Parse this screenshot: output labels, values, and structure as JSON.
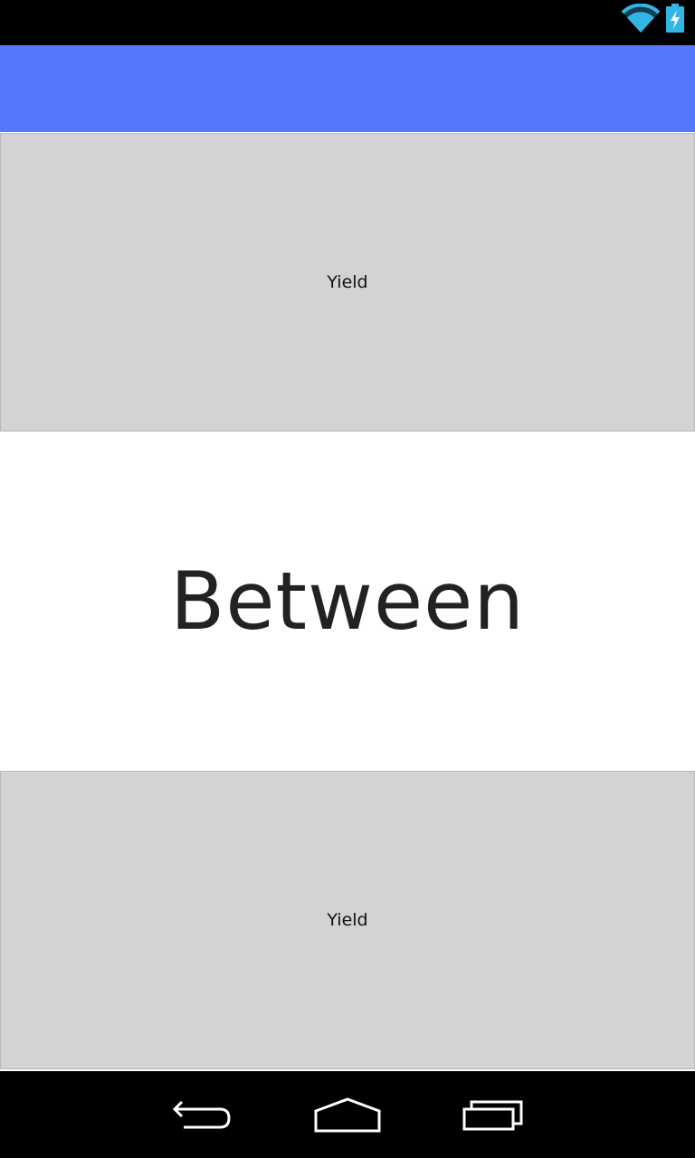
{
  "status_bar": {
    "icons": [
      "wifi-icon",
      "battery-charging-icon"
    ],
    "icon_color": "#33b5e5"
  },
  "app_bar": {
    "color": "#5677fc"
  },
  "main": {
    "top_box_label": "Yield",
    "center_text": "Between",
    "bottom_box_label": "Yield",
    "box_color": "#d3d3d3"
  },
  "nav_bar": {
    "buttons": [
      "back-icon",
      "home-icon",
      "recents-icon"
    ]
  }
}
